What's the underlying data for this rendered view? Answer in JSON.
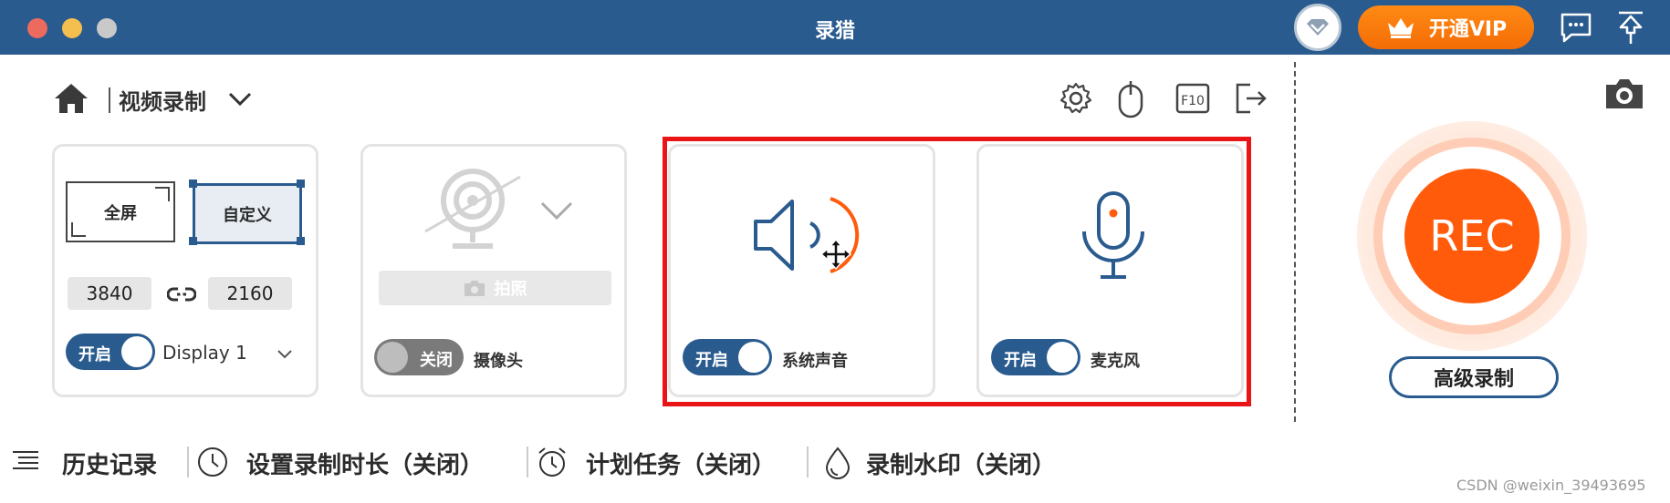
{
  "window": {
    "title": "录猎"
  },
  "header": {
    "vip_label": "开通VIP"
  },
  "mode": {
    "title": "视频录制"
  },
  "screen": {
    "full_label": "全屏",
    "custom_label": "自定义",
    "width": "3840",
    "height": "2160",
    "toggle_label": "开启",
    "display_label": "Display 1"
  },
  "camera": {
    "photo_label": "拍照",
    "toggle_label": "关闭",
    "label": "摄像头"
  },
  "system_audio": {
    "toggle_label": "开启",
    "label": "系统声音"
  },
  "microphone": {
    "toggle_label": "开启",
    "label": "麦克风"
  },
  "record": {
    "rec_label": "REC",
    "advanced_label": "高级录制"
  },
  "bottom": {
    "history": "历史记录",
    "duration": "设置录制时长（关闭）",
    "schedule": "计划任务（关闭）",
    "watermark": "录制水印（关闭）"
  },
  "footer": {
    "credit": "CSDN @weixin_39493695"
  },
  "colors": {
    "titlebar": "#2a5b8f",
    "accent_orange": "#ff5b0a",
    "highlight_red": "#e81416"
  }
}
